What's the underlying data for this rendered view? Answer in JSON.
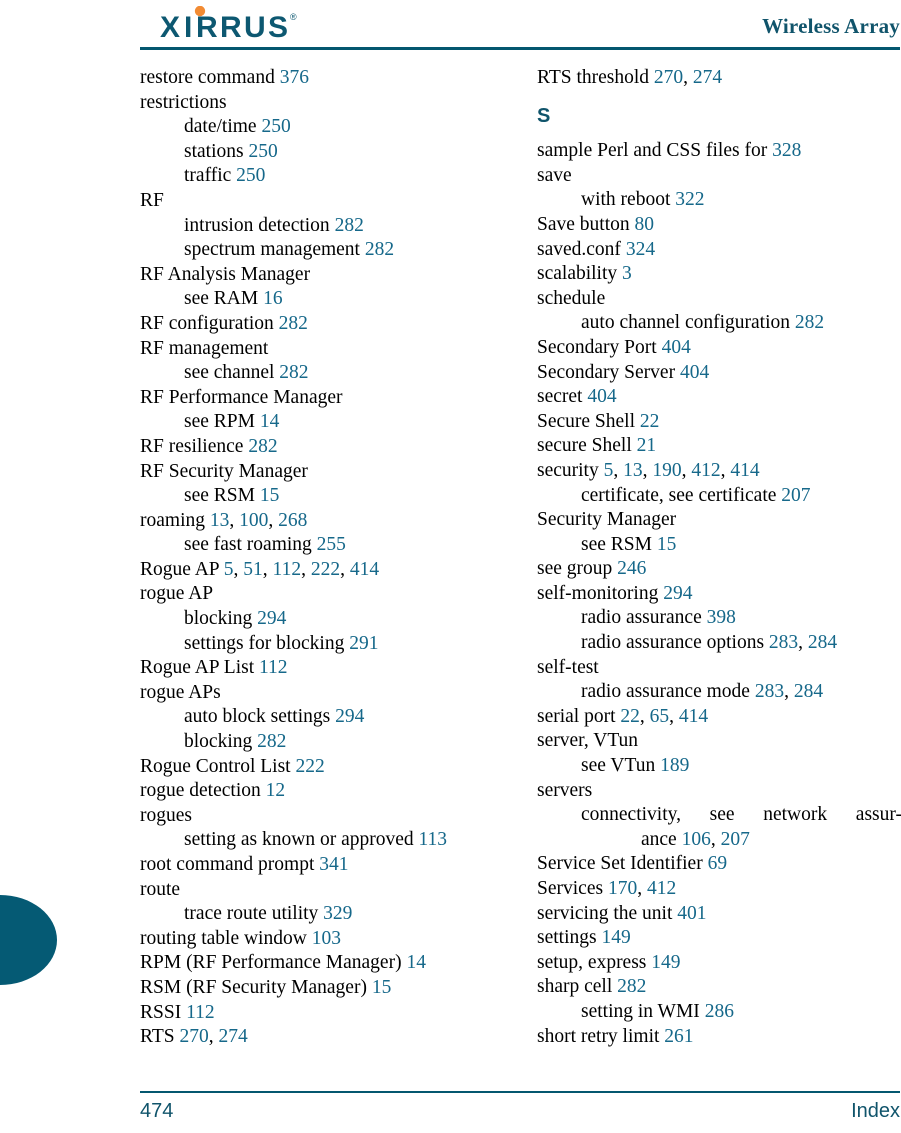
{
  "header": {
    "logo_alt": "XIRRUS",
    "logo_wordmark": "XIRRUS",
    "logo_trademark": "®",
    "title": "Wireless Array"
  },
  "footer": {
    "page_number": "474",
    "section_label": "Index"
  },
  "columns": {
    "left": [
      {
        "level": 1,
        "text": "restore command ",
        "pages": "376"
      },
      {
        "level": 1,
        "text": "restrictions",
        "pages": ""
      },
      {
        "level": 2,
        "text": "date/time ",
        "pages": "250"
      },
      {
        "level": 2,
        "text": "stations ",
        "pages": "250"
      },
      {
        "level": 2,
        "text": "traffic ",
        "pages": "250"
      },
      {
        "level": 1,
        "text": "RF",
        "pages": ""
      },
      {
        "level": 2,
        "text": "intrusion detection ",
        "pages": "282"
      },
      {
        "level": 2,
        "text": "spectrum management ",
        "pages": "282"
      },
      {
        "level": 1,
        "text": "RF Analysis Manager",
        "pages": ""
      },
      {
        "level": 2,
        "text": "see RAM ",
        "pages": "16"
      },
      {
        "level": 1,
        "text": "RF configuration ",
        "pages": "282"
      },
      {
        "level": 1,
        "text": "RF management",
        "pages": ""
      },
      {
        "level": 2,
        "text": "see channel ",
        "pages": "282"
      },
      {
        "level": 1,
        "text": "RF Performance Manager",
        "pages": ""
      },
      {
        "level": 2,
        "text": "see RPM ",
        "pages": "14"
      },
      {
        "level": 1,
        "text": "RF resilience ",
        "pages": "282"
      },
      {
        "level": 1,
        "text": "RF Security Manager",
        "pages": ""
      },
      {
        "level": 2,
        "text": "see RSM ",
        "pages": "15"
      },
      {
        "level": 1,
        "text": "roaming ",
        "pages": "13, 100, 268"
      },
      {
        "level": 2,
        "text": "see fast roaming ",
        "pages": "255"
      },
      {
        "level": 1,
        "text": "Rogue AP ",
        "pages": "5, 51, 112, 222, 414"
      },
      {
        "level": 1,
        "text": "rogue AP",
        "pages": ""
      },
      {
        "level": 2,
        "text": "blocking ",
        "pages": "294"
      },
      {
        "level": 2,
        "text": "settings for blocking ",
        "pages": "291"
      },
      {
        "level": 1,
        "text": "Rogue AP List ",
        "pages": "112"
      },
      {
        "level": 1,
        "text": "rogue APs",
        "pages": ""
      },
      {
        "level": 2,
        "text": "auto block settings ",
        "pages": "294"
      },
      {
        "level": 2,
        "text": "blocking ",
        "pages": "282"
      },
      {
        "level": 1,
        "text": "Rogue Control List ",
        "pages": "222"
      },
      {
        "level": 1,
        "text": "rogue detection ",
        "pages": "12"
      },
      {
        "level": 1,
        "text": "rogues",
        "pages": ""
      },
      {
        "level": 2,
        "text": "setting as known or approved ",
        "pages": "113"
      },
      {
        "level": 1,
        "text": "root command prompt ",
        "pages": "341"
      },
      {
        "level": 1,
        "text": "route",
        "pages": ""
      },
      {
        "level": 2,
        "text": "trace route utility ",
        "pages": "329"
      },
      {
        "level": 1,
        "text": "routing table window ",
        "pages": "103"
      },
      {
        "level": 1,
        "text": "RPM (RF Performance Manager) ",
        "pages": "14"
      },
      {
        "level": 1,
        "text": "RSM (RF Security Manager) ",
        "pages": "15"
      },
      {
        "level": 1,
        "text": "RSSI ",
        "pages": "112"
      },
      {
        "level": 1,
        "text": "RTS ",
        "pages": "270, 274"
      }
    ],
    "right": [
      {
        "level": 1,
        "text": "RTS threshold ",
        "pages": "270, 274"
      },
      {
        "level": "letter",
        "text": "S",
        "pages": ""
      },
      {
        "level": 1,
        "text": "sample Perl and CSS files for ",
        "pages": "328"
      },
      {
        "level": 1,
        "text": "save",
        "pages": ""
      },
      {
        "level": 2,
        "text": "with reboot ",
        "pages": "322"
      },
      {
        "level": 1,
        "text": "Save button ",
        "pages": "80"
      },
      {
        "level": 1,
        "text": "saved.conf ",
        "pages": "324"
      },
      {
        "level": 1,
        "text": "scalability ",
        "pages": "3"
      },
      {
        "level": 1,
        "text": "schedule",
        "pages": ""
      },
      {
        "level": 2,
        "text": "auto channel configuration ",
        "pages": "282"
      },
      {
        "level": 1,
        "text": "Secondary Port ",
        "pages": "404"
      },
      {
        "level": 1,
        "text": "Secondary Server ",
        "pages": "404"
      },
      {
        "level": 1,
        "text": "secret ",
        "pages": "404"
      },
      {
        "level": 1,
        "text": "Secure Shell ",
        "pages": "22"
      },
      {
        "level": 1,
        "text": "secure Shell ",
        "pages": "21"
      },
      {
        "level": 1,
        "text": "security ",
        "pages": "5, 13, 190, 412, 414"
      },
      {
        "level": 2,
        "text": "certificate, see certificate ",
        "pages": "207"
      },
      {
        "level": 1,
        "text": "Security Manager",
        "pages": ""
      },
      {
        "level": 2,
        "text": "see RSM ",
        "pages": "15"
      },
      {
        "level": 1,
        "text": "see group ",
        "pages": "246"
      },
      {
        "level": 1,
        "text": "self-monitoring ",
        "pages": "294"
      },
      {
        "level": 2,
        "text": "radio assurance ",
        "pages": "398"
      },
      {
        "level": 2,
        "text": "radio assurance options ",
        "pages": "283, 284"
      },
      {
        "level": 1,
        "text": "self-test",
        "pages": ""
      },
      {
        "level": 2,
        "text": "radio assurance mode ",
        "pages": "283, 284"
      },
      {
        "level": 1,
        "text": "serial port ",
        "pages": "22, 65, 414"
      },
      {
        "level": 1,
        "text": "server, VTun",
        "pages": ""
      },
      {
        "level": 2,
        "text": "see VTun ",
        "pages": "189"
      },
      {
        "level": 1,
        "text": "servers",
        "pages": ""
      },
      {
        "level": "wrap",
        "text": "connectivity, see network assur-",
        "cont_text": "ance ",
        "pages": "106, 207"
      },
      {
        "level": 1,
        "text": "Service Set Identifier ",
        "pages": "69"
      },
      {
        "level": 1,
        "text": "Services ",
        "pages": "170, 412"
      },
      {
        "level": 1,
        "text": "servicing the unit ",
        "pages": "401"
      },
      {
        "level": 1,
        "text": "settings ",
        "pages": "149"
      },
      {
        "level": 1,
        "text": "setup, express ",
        "pages": "149"
      },
      {
        "level": 1,
        "text": "sharp cell ",
        "pages": "282"
      },
      {
        "level": 2,
        "text": "setting in WMI ",
        "pages": "286"
      },
      {
        "level": 1,
        "text": "short retry limit ",
        "pages": "261"
      }
    ]
  },
  "colors": {
    "teal": "#10546b",
    "page_link": "#16688a",
    "rule": "#04576f",
    "logo_dark": "#0d5871",
    "logo_accent": "#f28b33"
  }
}
